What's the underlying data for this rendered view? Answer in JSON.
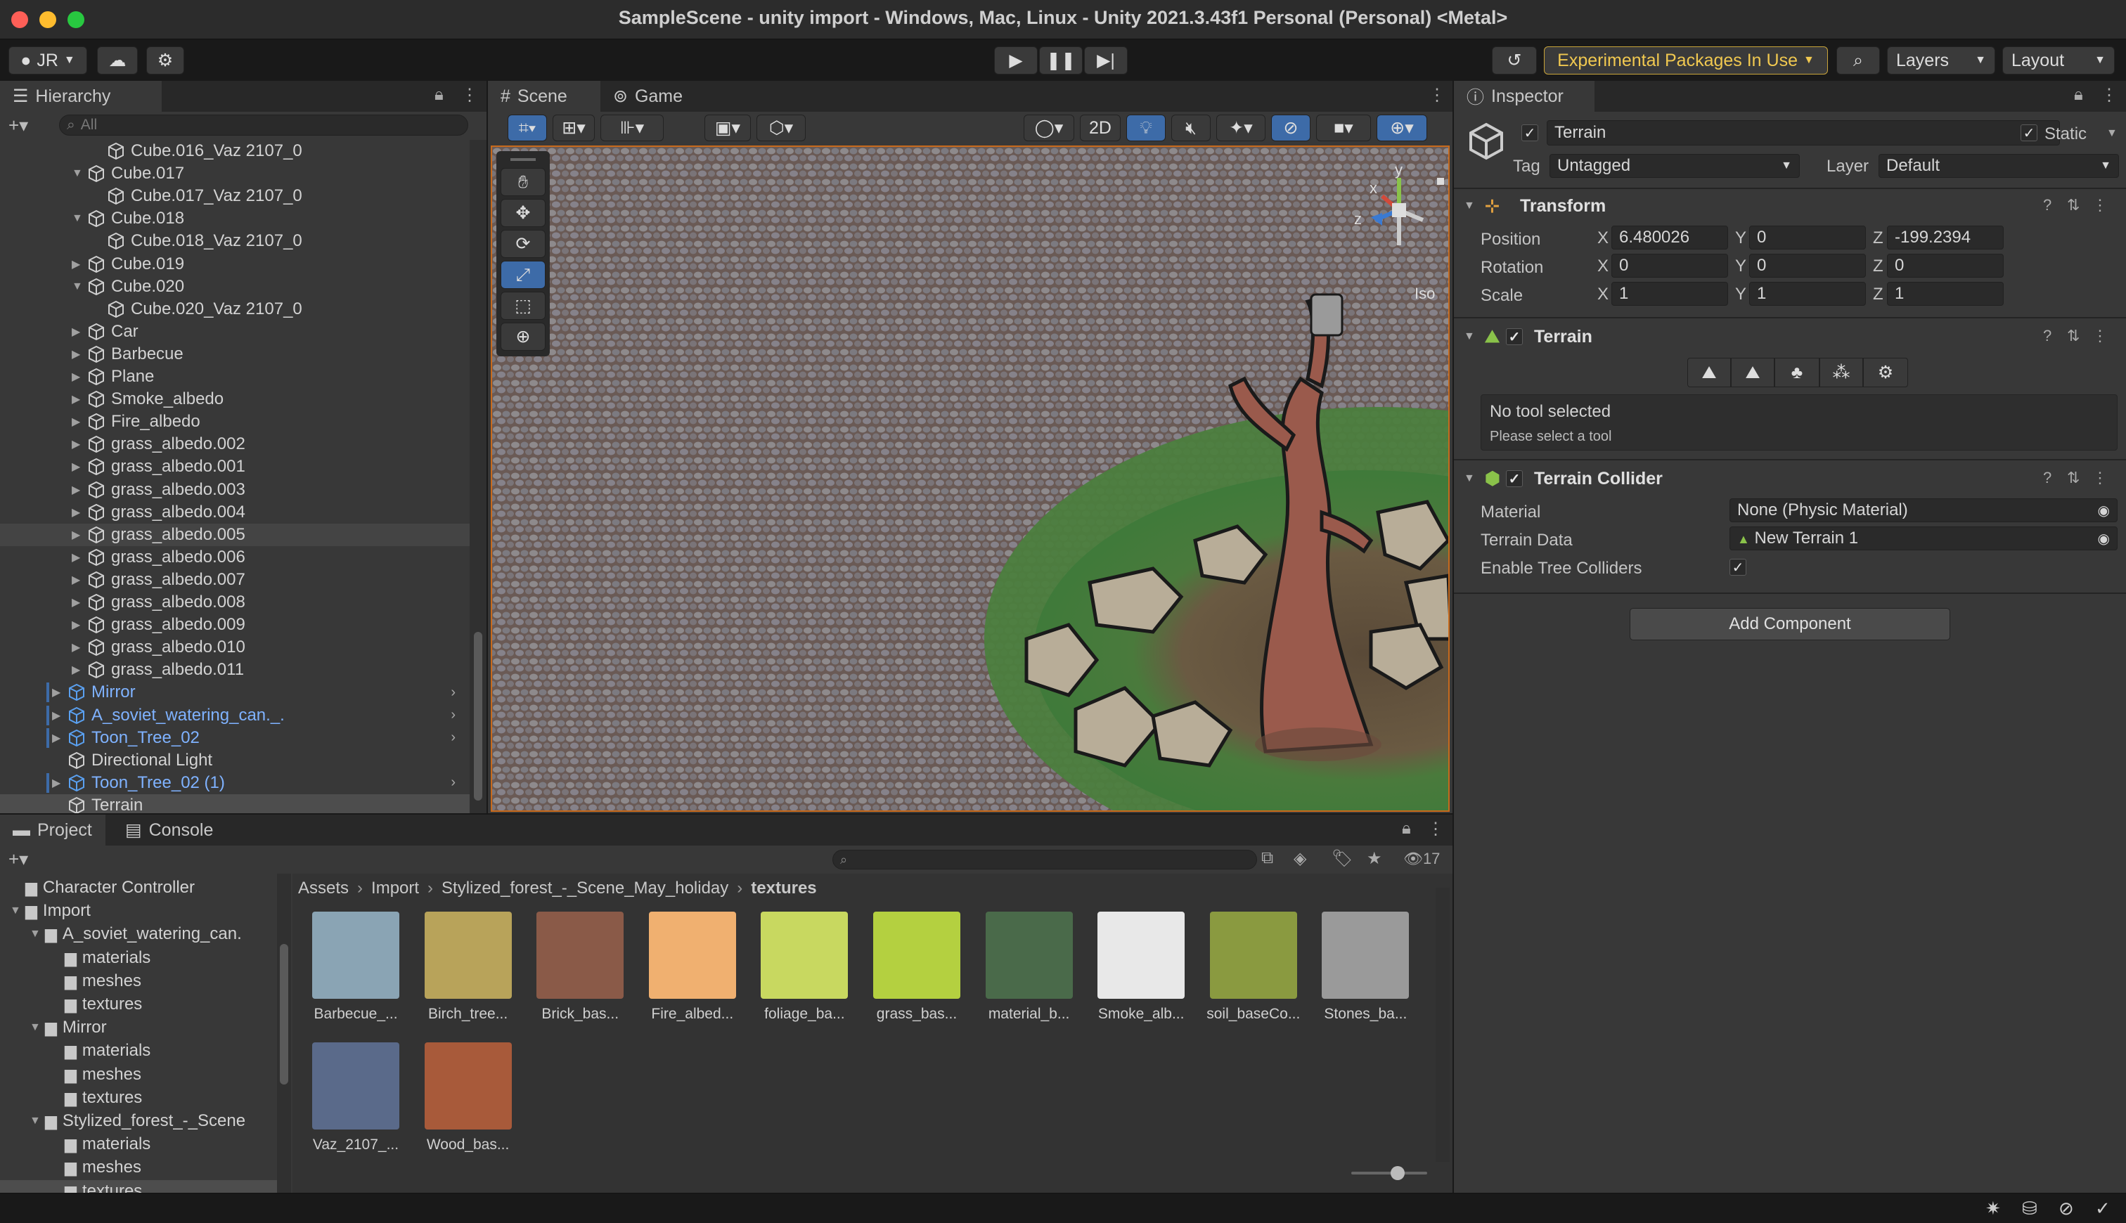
{
  "window": {
    "title": "SampleScene - unity import - Windows, Mac, Linux - Unity 2021.3.43f1 Personal (Personal) <Metal>"
  },
  "toolbar": {
    "account": "JR",
    "experimental_label": "Experimental Packages In Use",
    "layers_label": "Layers",
    "layout_label": "Layout"
  },
  "hierarchy": {
    "tab_label": "Hierarchy",
    "search_placeholder": "All",
    "items": [
      {
        "label": "Cube.016_Vaz 2107_0",
        "indent": 3,
        "arrow": "",
        "color": "normal"
      },
      {
        "label": "Cube.017",
        "indent": 2,
        "arrow": "▼",
        "color": "normal"
      },
      {
        "label": "Cube.017_Vaz 2107_0",
        "indent": 3,
        "arrow": "",
        "color": "normal"
      },
      {
        "label": "Cube.018",
        "indent": 2,
        "arrow": "▼",
        "color": "normal"
      },
      {
        "label": "Cube.018_Vaz 2107_0",
        "indent": 3,
        "arrow": "",
        "color": "normal"
      },
      {
        "label": "Cube.019",
        "indent": 2,
        "arrow": "▶",
        "color": "normal"
      },
      {
        "label": "Cube.020",
        "indent": 2,
        "arrow": "▼",
        "color": "normal"
      },
      {
        "label": "Cube.020_Vaz 2107_0",
        "indent": 3,
        "arrow": "",
        "color": "normal"
      },
      {
        "label": "Car",
        "indent": 2,
        "arrow": "▶",
        "color": "normal"
      },
      {
        "label": "Barbecue",
        "indent": 2,
        "arrow": "▶",
        "color": "normal"
      },
      {
        "label": "Plane",
        "indent": 2,
        "arrow": "▶",
        "color": "normal"
      },
      {
        "label": "Smoke_albedo",
        "indent": 2,
        "arrow": "▶",
        "color": "normal"
      },
      {
        "label": "Fire_albedo",
        "indent": 2,
        "arrow": "▶",
        "color": "normal"
      },
      {
        "label": "grass_albedo.002",
        "indent": 2,
        "arrow": "▶",
        "color": "normal"
      },
      {
        "label": "grass_albedo.001",
        "indent": 2,
        "arrow": "▶",
        "color": "normal"
      },
      {
        "label": "grass_albedo.003",
        "indent": 2,
        "arrow": "▶",
        "color": "normal"
      },
      {
        "label": "grass_albedo.004",
        "indent": 2,
        "arrow": "▶",
        "color": "normal"
      },
      {
        "label": "grass_albedo.005",
        "indent": 2,
        "arrow": "▶",
        "color": "normal"
      },
      {
        "label": "grass_albedo.006",
        "indent": 2,
        "arrow": "▶",
        "color": "normal"
      },
      {
        "label": "grass_albedo.007",
        "indent": 2,
        "arrow": "▶",
        "color": "normal"
      },
      {
        "label": "grass_albedo.008",
        "indent": 2,
        "arrow": "▶",
        "color": "normal"
      },
      {
        "label": "grass_albedo.009",
        "indent": 2,
        "arrow": "▶",
        "color": "normal"
      },
      {
        "label": "grass_albedo.010",
        "indent": 2,
        "arrow": "▶",
        "color": "normal"
      },
      {
        "label": "grass_albedo.011",
        "indent": 2,
        "arrow": "▶",
        "color": "normal"
      },
      {
        "label": "Mirror",
        "indent": 1,
        "arrow": "▶",
        "color": "prefab"
      },
      {
        "label": "A_soviet_watering_can._.",
        "indent": 1,
        "arrow": "▶",
        "color": "prefab"
      },
      {
        "label": "Toon_Tree_02",
        "indent": 1,
        "arrow": "▶",
        "color": "prefab"
      },
      {
        "label": "Directional Light",
        "indent": 1,
        "arrow": "",
        "color": "normal"
      },
      {
        "label": "Toon_Tree_02 (1)",
        "indent": 1,
        "arrow": "▶",
        "color": "prefab"
      },
      {
        "label": "Terrain",
        "indent": 1,
        "arrow": "",
        "color": "selected"
      }
    ]
  },
  "scene": {
    "tab_scene": "Scene",
    "tab_game": "Game",
    "btn_2d": "2D",
    "gizmo_x": "x",
    "gizmo_y": "y",
    "gizmo_z": "z",
    "iso_label": "Iso"
  },
  "inspector": {
    "tab_label": "Inspector",
    "object_name": "Terrain",
    "static_label": "Static",
    "tag_label": "Tag",
    "tag_value": "Untagged",
    "layer_label": "Layer",
    "layer_value": "Default",
    "transform": {
      "title": "Transform",
      "position_label": "Position",
      "rotation_label": "Rotation",
      "scale_label": "Scale",
      "position": {
        "x": "6.480026",
        "y": "0",
        "z": "-199.2394"
      },
      "rotation": {
        "x": "0",
        "y": "0",
        "z": "0"
      },
      "scale": {
        "x": "1",
        "y": "1",
        "z": "1"
      }
    },
    "terrain": {
      "title": "Terrain",
      "no_tool": "No tool selected",
      "please_select": "Please select a tool"
    },
    "collider": {
      "title": "Terrain Collider",
      "material_label": "Material",
      "material_value": "None (Physic Material)",
      "terrain_data_label": "Terrain Data",
      "terrain_data_value": "New Terrain 1",
      "enable_tree_label": "Enable Tree Colliders"
    },
    "add_component": "Add Component"
  },
  "project": {
    "tab_project": "Project",
    "tab_console": "Console",
    "hidden_count": "17",
    "folders": [
      {
        "label": "Character Controller",
        "indent": 1,
        "arrow": ""
      },
      {
        "label": "Import",
        "indent": 1,
        "arrow": "▼"
      },
      {
        "label": "A_soviet_watering_can.",
        "indent": 2,
        "arrow": "▼"
      },
      {
        "label": "materials",
        "indent": 3,
        "arrow": ""
      },
      {
        "label": "meshes",
        "indent": 3,
        "arrow": ""
      },
      {
        "label": "textures",
        "indent": 3,
        "arrow": ""
      },
      {
        "label": "Mirror",
        "indent": 2,
        "arrow": "▼"
      },
      {
        "label": "materials",
        "indent": 3,
        "arrow": ""
      },
      {
        "label": "meshes",
        "indent": 3,
        "arrow": ""
      },
      {
        "label": "textures",
        "indent": 3,
        "arrow": ""
      },
      {
        "label": "Stylized_forest_-_Scene",
        "indent": 2,
        "arrow": "▼"
      },
      {
        "label": "materials",
        "indent": 3,
        "arrow": ""
      },
      {
        "label": "meshes",
        "indent": 3,
        "arrow": ""
      },
      {
        "label": "textures",
        "indent": 3,
        "arrow": ""
      }
    ],
    "breadcrumb": [
      "Assets",
      "Import",
      "Stylized_forest_-_Scene_May_holiday",
      "textures"
    ],
    "assets": [
      {
        "label": "Barbecue_...",
        "color": "#8aa4b4"
      },
      {
        "label": "Birch_tree...",
        "color": "#b8a35a"
      },
      {
        "label": "Brick_bas...",
        "color": "#8a5a48"
      },
      {
        "label": "Fire_albed...",
        "color": "#f0b070"
      },
      {
        "label": "foliage_ba...",
        "color": "#c8d860"
      },
      {
        "label": "grass_bas...",
        "color": "#b4d040"
      },
      {
        "label": "material_b...",
        "color": "#4a6a4a"
      },
      {
        "label": "Smoke_alb...",
        "color": "#e8e8e8"
      },
      {
        "label": "soil_baseCo...",
        "color": "#8a9a40"
      },
      {
        "label": "Stones_ba...",
        "color": "#9a9a9a"
      },
      {
        "label": "Vaz_2107_...",
        "color": "#5a6a8a"
      },
      {
        "label": "Wood_bas...",
        "color": "#a85a3a"
      }
    ]
  },
  "colors": {
    "accent": "#3d6ba8",
    "prefab": "#7fb2ff",
    "selection": "#2c5d87",
    "experimental": "#e0b040"
  }
}
